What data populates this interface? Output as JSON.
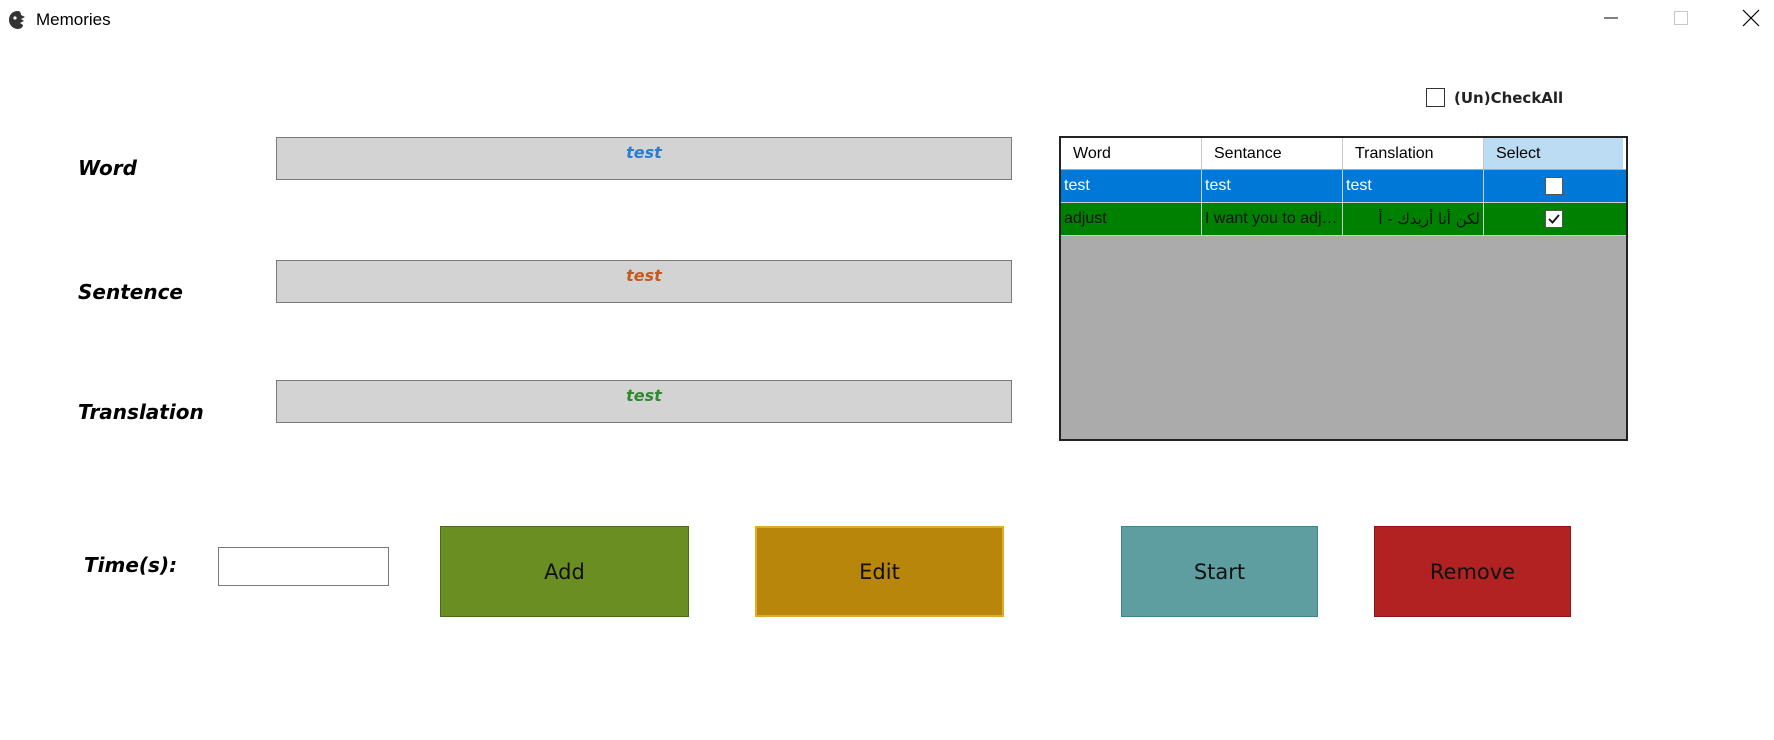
{
  "window": {
    "title": "Memories",
    "icon": "app-logo-icon",
    "controls": [
      "minimize-icon",
      "maximize-icon",
      "close-icon"
    ]
  },
  "form": {
    "word_label": "Word",
    "sentence_label": "Sentence",
    "translation_label": "Translation",
    "times_label": "Time(s):",
    "word_value": "test",
    "sentence_value": "test",
    "translation_value": "test",
    "times_value": "",
    "colors": {
      "word": "#2a7dd1",
      "sentence": "#c65a1e",
      "translation": "#2e8b2e"
    }
  },
  "check_all": {
    "label": "(Un)CheckAll",
    "checked": false
  },
  "grid": {
    "columns": [
      "Word",
      "Sentance",
      "Translation",
      "Select"
    ],
    "rows": [
      {
        "word": "test",
        "sentence": "test",
        "translation": "test",
        "selected": false,
        "color": "#0078d7"
      },
      {
        "word": "adjust",
        "sentence": "I want you to adjust",
        "translation": "لكن أنا أريدك - أ",
        "selected": true,
        "color": "#008000"
      }
    ]
  },
  "buttons": {
    "add": "Add",
    "edit": "Edit",
    "start": "Start",
    "remove": "Remove",
    "colors": {
      "add": "#6b8e23",
      "edit": "#b8860b",
      "start": "#5f9ea0",
      "remove": "#b22222"
    }
  }
}
